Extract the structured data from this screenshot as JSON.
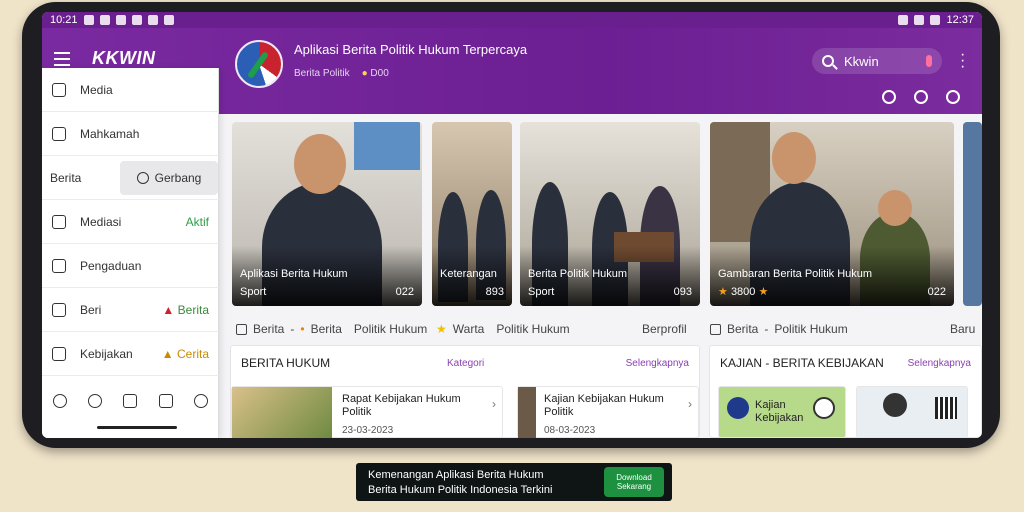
{
  "status_bar": {
    "time_left": "10:21",
    "time_right": "12:37"
  },
  "header": {
    "brand": "KKWIN",
    "app_title": "Aplikasi Berita Politik Hukum Terpercaya",
    "app_sub_left": "Berita Politik",
    "app_sub_right": "D00",
    "search_value": "Kkwin"
  },
  "sidebar": {
    "items": [
      {
        "label": "Media"
      },
      {
        "label": "Mahkamah"
      }
    ],
    "group_label": "Berita",
    "chip_label": "Gerbang",
    "items2": [
      {
        "label": "Mediasi",
        "right": "Aktif",
        "right_color": "#2e9e45"
      },
      {
        "label": "Pengaduan",
        "right": ""
      },
      {
        "label": "Beri",
        "right": "Berita",
        "right_color": "#3a8a3a"
      },
      {
        "label": "Kebijakan",
        "right": "Cerita",
        "right_color": "#c98a00"
      }
    ]
  },
  "cards": [
    {
      "title": "Aplikasi Berita Hukum",
      "sub": "Sport",
      "num": "022"
    },
    {
      "title": "Keterangan",
      "sub": "",
      "num": "893"
    },
    {
      "title": "Berita Politik Hukum",
      "sub": "Sport",
      "num": "093"
    },
    {
      "title": "Gambaran Berita Politik Hukum",
      "sub": "3800",
      "num": "022"
    }
  ],
  "meta": {
    "left_tag": "Berita",
    "left_label": "Berita",
    "left_sub": "Politik Hukum",
    "mid_label": "Warta",
    "mid_sub": "Politik Hukum",
    "right_date": "Berprofil",
    "right_tag": "Berita",
    "right_sub": "Politik Hukum",
    "far_right": "Baru"
  },
  "panel_left": {
    "title": "BERITA HUKUM",
    "link1": "Kategori",
    "link2": "Selengkapnya",
    "items": [
      {
        "title": "Rapat Kebijakan Hukum Politik",
        "date": "23-03-2023"
      },
      {
        "title": "Kajian Kebijakan Hukum Politik",
        "date": "08-03-2023"
      }
    ]
  },
  "panel_right": {
    "title": "KAJIAN - BERITA KEBIJAKAN",
    "link": "Selengkapnya",
    "items": [
      {
        "title": "Kajian Kebijakan"
      }
    ]
  },
  "ad": {
    "line1": "Kemenangan Aplikasi Berita Hukum",
    "line2": "Berita Hukum Politik Indonesia Terkini",
    "button": "Download Sekarang"
  }
}
